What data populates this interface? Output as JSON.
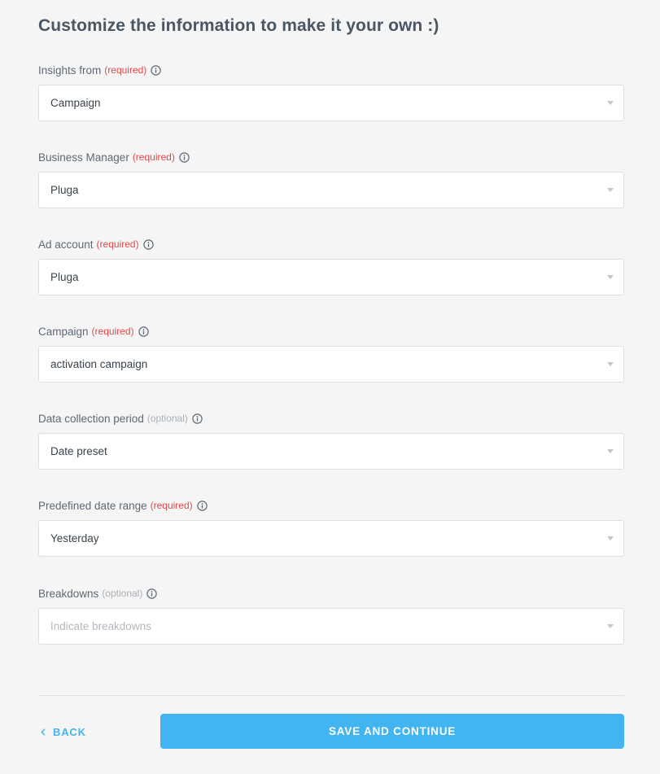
{
  "title": "Customize the information to make it your own :)",
  "fields": [
    {
      "label": "Insights from",
      "tag": "(required)",
      "value": "Campaign"
    },
    {
      "label": "Business Manager",
      "tag": "(required)",
      "value": "Pluga"
    },
    {
      "label": "Ad account",
      "tag": "(required)",
      "value": "Pluga"
    },
    {
      "label": "Campaign",
      "tag": "(required)",
      "value": "activation campaign"
    },
    {
      "label": "Data collection period",
      "tag": "(optional)",
      "value": "Date preset"
    },
    {
      "label": "Predefined date range",
      "tag": "(required)",
      "value": "Yesterday"
    },
    {
      "label": "Breakdowns",
      "tag": "(optional)",
      "placeholder": "Indicate breakdowns"
    }
  ],
  "footer": {
    "back_label": "BACK",
    "save_label": "SAVE AND CONTINUE"
  },
  "colors": {
    "required": "#e0484a",
    "optional": "#a9b0b7",
    "accent": "#42b4f2",
    "background": "#f5f5f5"
  },
  "icons": [
    "info-icon",
    "caret-down-icon",
    "chevron-left-icon"
  ]
}
